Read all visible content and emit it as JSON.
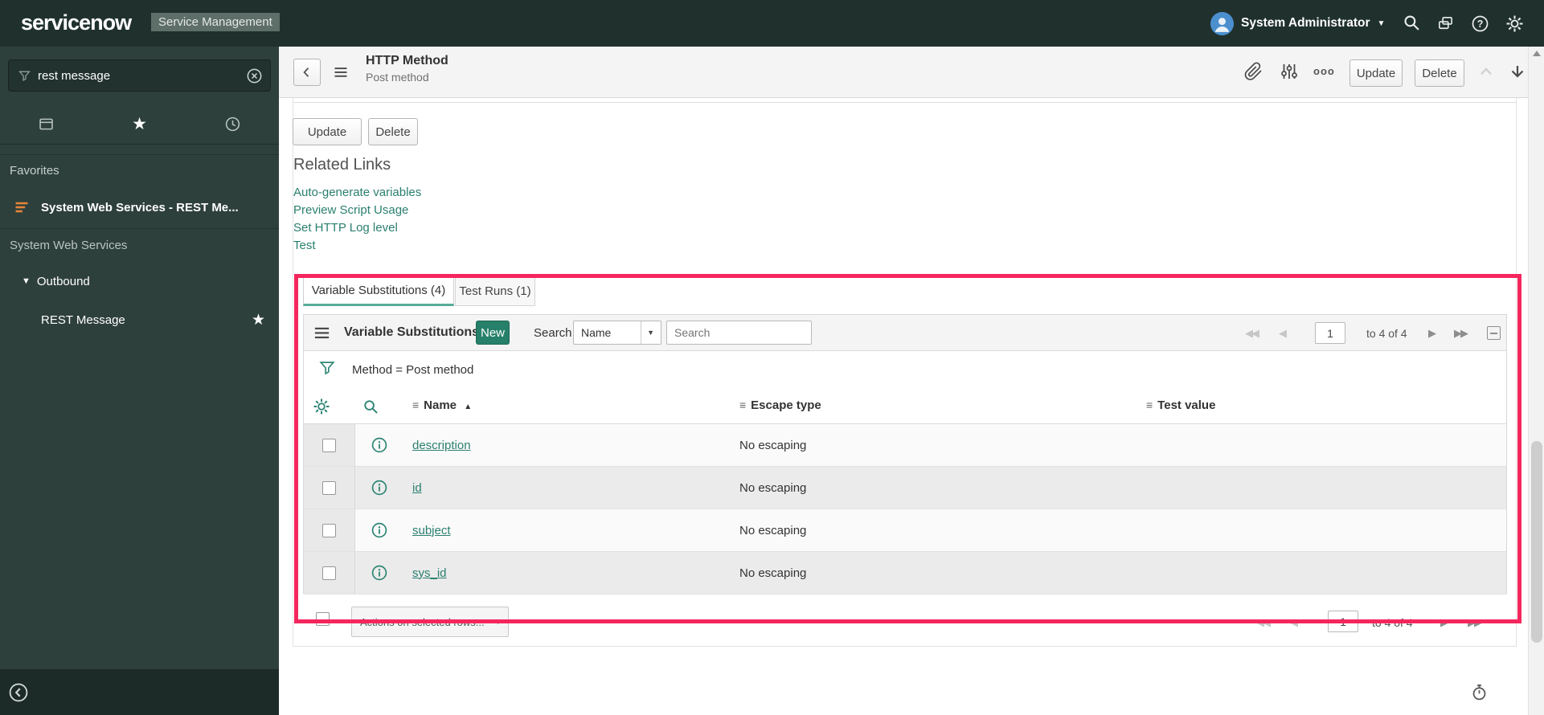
{
  "header": {
    "logo": "servicenow",
    "app_label": "Service Management",
    "user_name": "System Administrator"
  },
  "sidebar": {
    "search_value": "rest message",
    "favorites_label": "Favorites",
    "favorite_item": "System Web Services - REST Me...",
    "section_label": "System Web Services",
    "outbound_label": "Outbound",
    "rest_message_label": "REST Message"
  },
  "toolbar": {
    "title": "HTTP Method",
    "subtitle": "Post method",
    "update": "Update",
    "delete": "Delete"
  },
  "form": {
    "update": "Update",
    "delete": "Delete",
    "related_links_title": "Related Links",
    "links": [
      "Auto-generate variables",
      "Preview Script Usage",
      "Set HTTP Log level",
      "Test"
    ]
  },
  "tabs": [
    {
      "label": "Variable Substitutions (4)"
    },
    {
      "label": "Test Runs (1)"
    }
  ],
  "list": {
    "title": "Variable Substitutions",
    "new_button": "New",
    "search_label": "Search",
    "search_column": "Name",
    "search_placeholder": "Search",
    "filter": "Method = Post method",
    "page": "1",
    "range": "to 4 of 4",
    "columns": [
      "Name",
      "Escape type",
      "Test value"
    ],
    "rows": [
      {
        "name": "description",
        "escape_type": "No escaping",
        "test_value": ""
      },
      {
        "name": "id",
        "escape_type": "No escaping",
        "test_value": ""
      },
      {
        "name": "subject",
        "escape_type": "No escaping",
        "test_value": ""
      },
      {
        "name": "sys_id",
        "escape_type": "No escaping",
        "test_value": ""
      }
    ],
    "actions": "Actions on selected rows..."
  },
  "glyphs": {
    "more": "ooo",
    "star": "★",
    "caret_down": "▼",
    "sort_asc": "▲",
    "col_menu": "≡",
    "first": "◀◀",
    "prev": "◀",
    "next": "▶",
    "last": "▶▶"
  },
  "colors": {
    "accent_teal": "#2e8575",
    "link_teal": "#2a7f6f",
    "annotation_red": "#f5265d",
    "header_bg": "#20312d",
    "sidebar_bg": "#2e403c"
  }
}
